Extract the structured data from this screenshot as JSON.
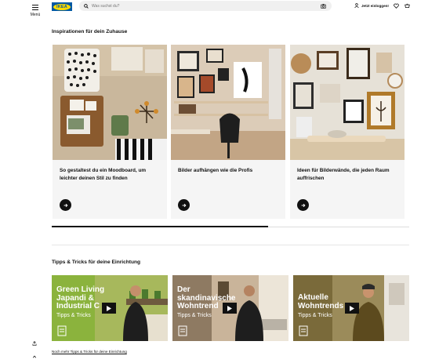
{
  "header": {
    "menu_label": "Menü",
    "logo_text": "IKEA",
    "search_placeholder": "Was suchst du?",
    "login_label": "Jetzt einloggen!"
  },
  "inspiration": {
    "heading": "Inspirationen für dein Zuhause",
    "cards": [
      {
        "title": "So gestaltest du ein Moodboard, um leichter deinen Stil zu finden"
      },
      {
        "title": "Bilder aufhängen wie die Profis"
      },
      {
        "title": "Ideen für Bilderwände, die jeden Raum auffrischen"
      }
    ]
  },
  "tips": {
    "heading": "Tipps & Tricks für deine Einrichtung",
    "videos": [
      {
        "lines": [
          "Green Living",
          "Japandi &",
          "Industrial C"
        ],
        "sub": "Tipps & Tricks",
        "color": "#8bb33d"
      },
      {
        "lines": [
          "Der",
          "skandinavische",
          "Wohntrend"
        ],
        "sub": "Tipps & Tricks",
        "color": "#8e7a62"
      },
      {
        "lines": [
          "Aktuelle",
          "Wohntrends"
        ],
        "sub": "Tipps & Tricks",
        "color": "#7a6a3a"
      }
    ],
    "more_link": "Noch mehr Tipps & Tricks für deine Einrichtung"
  },
  "colors": {
    "ikea_blue": "#0058a3",
    "ikea_yellow": "#ffdb00",
    "card_bg": "#f5f5f5"
  }
}
